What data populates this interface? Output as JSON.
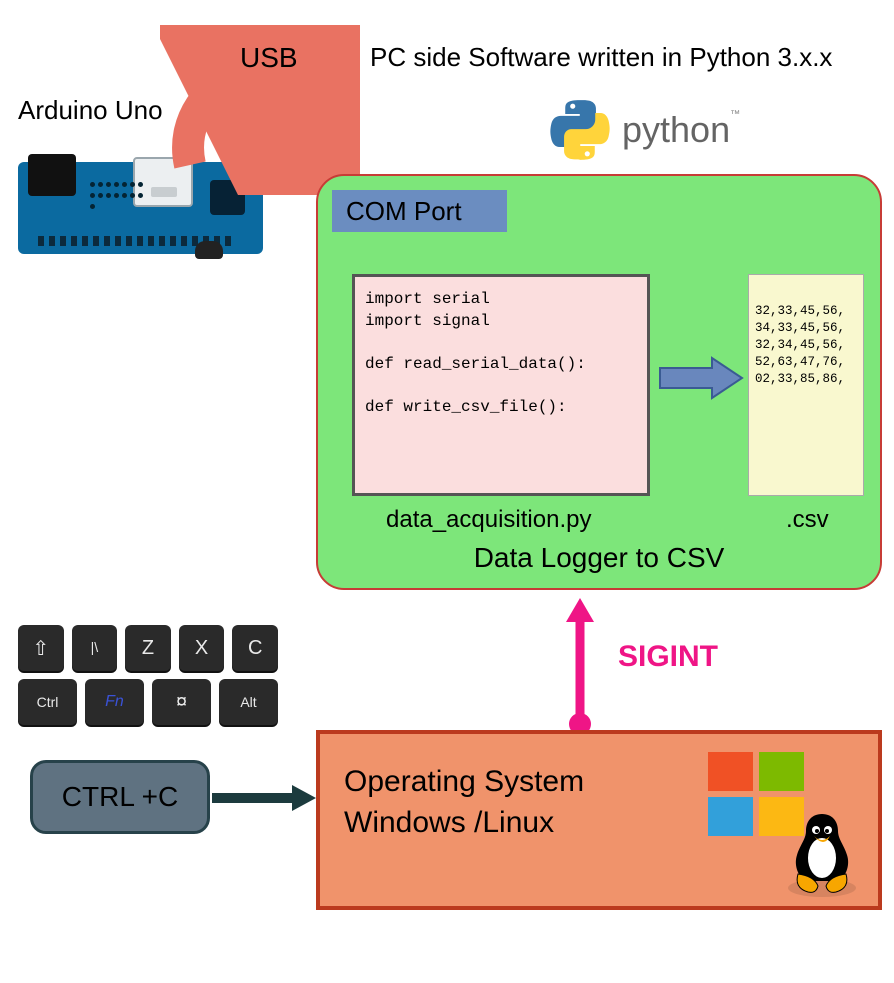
{
  "arduino": {
    "label": "Arduino Uno"
  },
  "usb": {
    "label": "USB"
  },
  "pc_headline": "PC side Software written in Python 3.x.x",
  "python": {
    "word": "python",
    "tm": "™"
  },
  "logger": {
    "com_port": "COM Port",
    "code": "import serial\nimport signal\n\ndef read_serial_data():\n\ndef write_csv_file():",
    "code_caption": "data_acquisition.py",
    "csv_text": "32,33,45,56,\n34,33,45,56,\n32,34,45,56,\n52,63,47,76,\n02,33,85,86,",
    "csv_caption": ".csv",
    "title": "Data Logger to CSV"
  },
  "keys": {
    "row1": [
      "⇧",
      "|\\",
      "Z",
      "X",
      "C"
    ],
    "row2": [
      "Ctrl",
      "Fn",
      "¤",
      "Alt"
    ]
  },
  "ctrlc": {
    "label": "CTRL +C"
  },
  "sigint": {
    "label": "SIGINT"
  },
  "os": {
    "line1": "Operating System",
    "line2": "Windows /Linux"
  },
  "colors": {
    "usb_arrow": "#e97262",
    "green_box": "#7de67a",
    "green_border": "#c73c36",
    "code_bg": "#fbdede",
    "csv_bg": "#f9f8cf",
    "flow_arrow": "#6987bd",
    "sigint": "#ef1586",
    "os_bg": "#f0936b",
    "os_border": "#bb3a1e",
    "ctrlc_bg": "#5f7281",
    "ctrlc_border": "#27424a",
    "ctrlc_arrow": "#1c3b3e"
  }
}
